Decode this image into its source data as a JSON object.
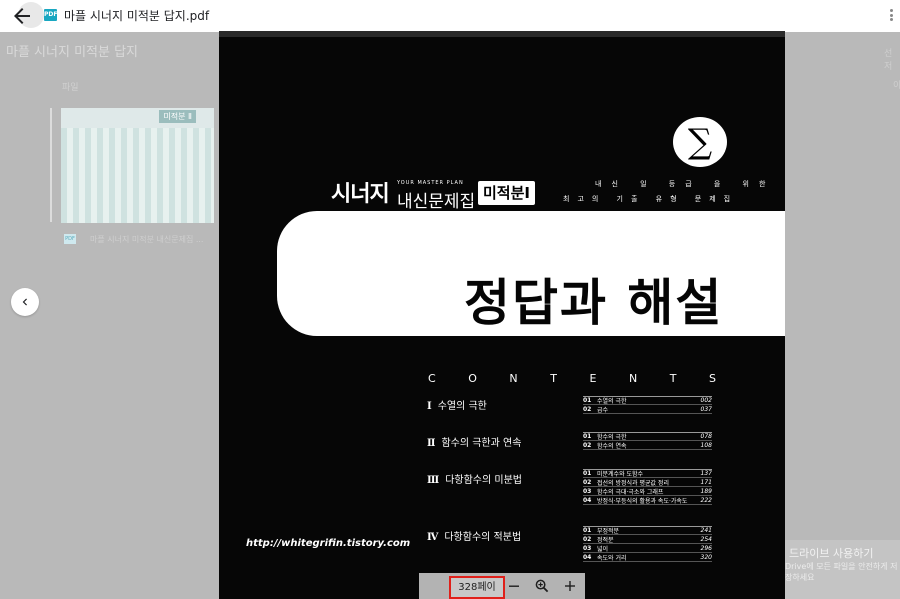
{
  "window": {
    "title": "마플 시너지 미적분 답지.pdf",
    "file_badge": "PDF"
  },
  "background": {
    "folder_title": "마플 시너지 미적분 답지",
    "section_label": "파일",
    "right_label": "선저",
    "right_label2": "이",
    "thumb_tag": "미적분 Ⅱ",
    "file_name": "마플 시너지 미적분 내신문제집 ..."
  },
  "promo": {
    "title": "드라이브 사용하기",
    "body": "Drive에 모든 파일을 안전하게 저장하세요"
  },
  "document": {
    "brand_main": "시너지",
    "brand_master": "YOUR MASTER PLAN",
    "brand_sub": "내신문제집",
    "brand_badge": "미적분Ⅰ",
    "tagline1": "내신 일 등급 을 위한",
    "tagline2": "최고의 기출 유형 문제집",
    "main_title": "정답과 해설",
    "contents_letters": [
      "C",
      "O",
      "N",
      "T",
      "E",
      "N",
      "T",
      "S"
    ],
    "sections": [
      {
        "num": "Ⅰ",
        "title": "수열의 극한",
        "entries": [
          {
            "n": "01",
            "t": "수열의 극한",
            "p": "002"
          },
          {
            "n": "02",
            "t": "급수",
            "p": "037"
          }
        ]
      },
      {
        "num": "Ⅱ",
        "title": "함수의 극한과 연속",
        "entries": [
          {
            "n": "01",
            "t": "함수의 극한",
            "p": "078"
          },
          {
            "n": "02",
            "t": "함수의 연속",
            "p": "108"
          }
        ]
      },
      {
        "num": "Ⅲ",
        "title": "다항함수의 미분법",
        "entries": [
          {
            "n": "01",
            "t": "미분계수와 도함수",
            "p": "137"
          },
          {
            "n": "02",
            "t": "접선의 방정식과 평균값 정리",
            "p": "171"
          },
          {
            "n": "03",
            "t": "함수의 극대·극소와 그래프",
            "p": "189"
          },
          {
            "n": "04",
            "t": "방정식·부등식의 활용과 속도·가속도",
            "p": "222"
          }
        ]
      },
      {
        "num": "Ⅳ",
        "title": "다항함수의 적분법",
        "entries": [
          {
            "n": "01",
            "t": "부정적분",
            "p": "241"
          },
          {
            "n": "02",
            "t": "정적분",
            "p": "254"
          },
          {
            "n": "03",
            "t": "넓이",
            "p": "296"
          },
          {
            "n": "04",
            "t": "속도와 거리",
            "p": "320"
          }
        ]
      }
    ],
    "url": "http://whitegrifin.tistory.com"
  },
  "toolbar": {
    "page_indicator": "328페이"
  },
  "icons": {
    "back": "arrow-left-icon",
    "more": "more-vert-icon",
    "prev": "chevron-left-icon",
    "zoom_out": "minus-icon",
    "zoom_in": "zoom-in-icon",
    "add": "plus-icon"
  }
}
